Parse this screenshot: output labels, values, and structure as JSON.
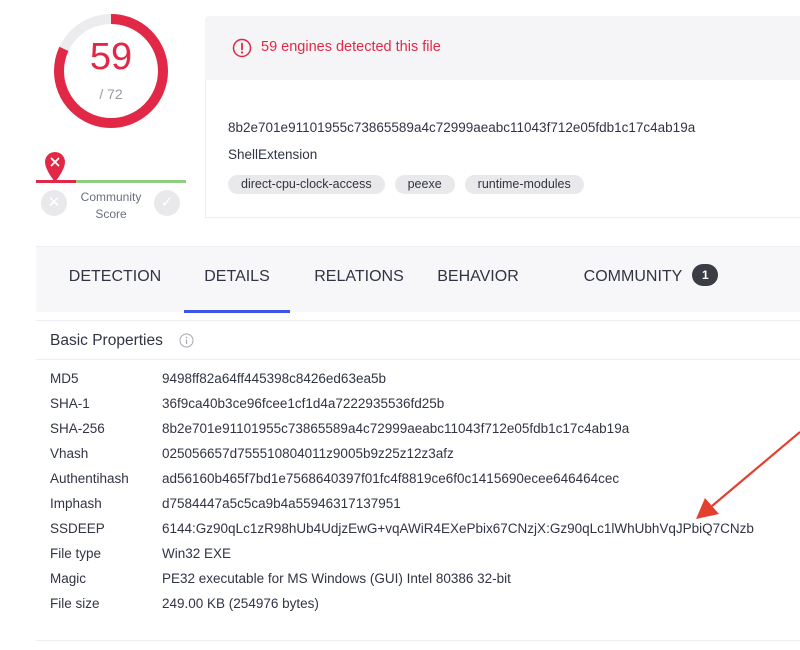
{
  "score": {
    "detected": "59",
    "total": "/ 72",
    "community_label_1": "Community",
    "community_label_2": "Score",
    "gauge_fraction": 0.819,
    "colors": {
      "malicious": "#e12947",
      "harmless": "#8fce81"
    }
  },
  "banner": {
    "text": "59 engines detected this file",
    "icon": "alert-circle-icon",
    "color": "#e12947"
  },
  "file": {
    "sha256": "8b2e701e91101955c73865589a4c72999aeabc11043f712e05fdb1c17c4ab19a",
    "name": "ShellExtension",
    "tags": [
      "direct-cpu-clock-access",
      "peexe",
      "runtime-modules"
    ]
  },
  "tabs": {
    "detection": "DETECTION",
    "details": "DETAILS",
    "relations": "RELATIONS",
    "behavior": "BEHAVIOR",
    "community": "COMMUNITY",
    "community_count": "1",
    "active": "DETAILS",
    "accent": "#3d56e8"
  },
  "basic_properties": {
    "title": "Basic Properties",
    "rows": [
      {
        "key": "MD5",
        "value": "9498ff82a64ff445398c8426ed63ea5b"
      },
      {
        "key": "SHA-1",
        "value": "36f9ca40b3ce96fcee1cf1d4a7222935536fd25b"
      },
      {
        "key": "SHA-256",
        "value": "8b2e701e91101955c73865589a4c72999aeabc11043f712e05fdb1c17c4ab19a"
      },
      {
        "key": "Vhash",
        "value": "025056657d755510804011z9005b9z25z12z3afz"
      },
      {
        "key": "Authentihash",
        "value": "ad56160b465f7bd1e7568640397f01fc4f8819ce6f0c1415690ecee646464cec"
      },
      {
        "key": "Imphash",
        "value": "d7584447a5c5ca9b4a55946317137951"
      },
      {
        "key": "SSDEEP",
        "value": "6144:Gz90qLc1zR98hUb4UdjzEwG+vqAWiR4EXePbix67CNzjX:Gz90qLc1lWhUbhVqJPbiQ7CNzb"
      },
      {
        "key": "File type",
        "value": "Win32 EXE"
      },
      {
        "key": "Magic",
        "value": "PE32 executable for MS Windows (GUI) Intel 80386 32-bit"
      },
      {
        "key": "File size",
        "value": "249.00 KB (254976 bytes)"
      }
    ]
  }
}
